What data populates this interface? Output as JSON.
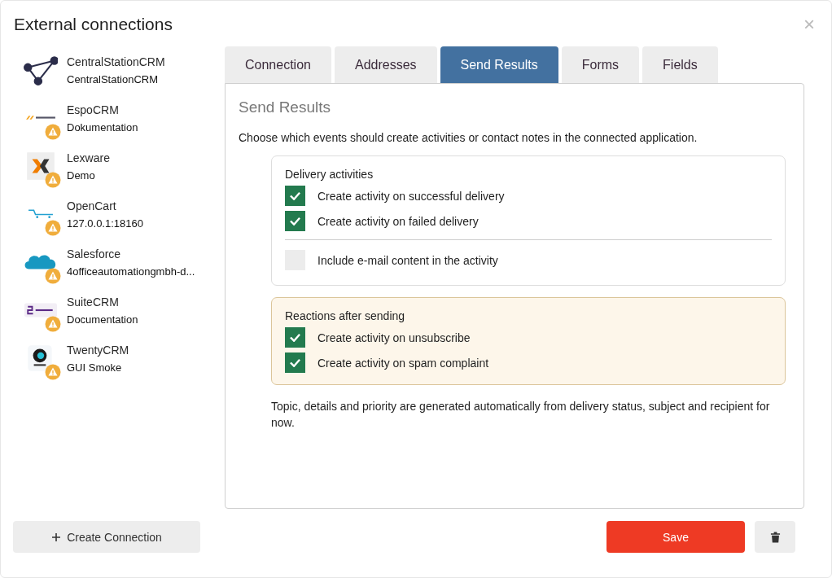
{
  "dialog": {
    "title": "External connections",
    "close": "×"
  },
  "connections": [
    {
      "name": "CentralStationCRM",
      "detail": "CentralStationCRM",
      "kind": "graph",
      "warning": false
    },
    {
      "name": "EspoCRM",
      "detail": "Dokumentation",
      "kind": "espo",
      "warning": true
    },
    {
      "name": "Lexware",
      "detail": "Demo",
      "kind": "lexware",
      "warning": true
    },
    {
      "name": "OpenCart",
      "detail": "127.0.0.1:18160",
      "kind": "opencart",
      "warning": true
    },
    {
      "name": "Salesforce",
      "detail": "4officeautomationgmbh-d...",
      "kind": "salesforce",
      "warning": true
    },
    {
      "name": "SuiteCRM",
      "detail": "Documentation",
      "kind": "suitecrm",
      "warning": true
    },
    {
      "name": "TwentyCRM",
      "detail": "GUI Smoke",
      "kind": "twenty",
      "warning": true
    }
  ],
  "tabs": [
    {
      "label": "Connection",
      "selected": false
    },
    {
      "label": "Addresses",
      "selected": false
    },
    {
      "label": "Send Results",
      "selected": true
    },
    {
      "label": "Forms",
      "selected": false
    },
    {
      "label": "Fields",
      "selected": false
    }
  ],
  "panel": {
    "title": "Send Results",
    "intro": "Choose which events should create activities or contact notes in the connected application.",
    "sections": [
      {
        "title": "Delivery activities",
        "kind": "plain",
        "groups": [
          [
            {
              "label": "Create activity on successful delivery",
              "checked": true
            },
            {
              "label": "Create activity on failed delivery",
              "checked": true
            }
          ],
          [
            {
              "label": "Include e-mail content in the activity",
              "checked": false
            }
          ]
        ]
      },
      {
        "title": "Reactions after sending",
        "kind": "highlight",
        "groups": [
          [
            {
              "label": "Create activity on unsubscribe",
              "checked": true
            },
            {
              "label": "Create activity on spam complaint",
              "checked": true
            }
          ]
        ]
      }
    ],
    "note": "Topic, details and priority are generated automatically from delivery status, subject and recipient for now."
  },
  "footer": {
    "create_label": "Create Connection",
    "save_label": "Save"
  }
}
